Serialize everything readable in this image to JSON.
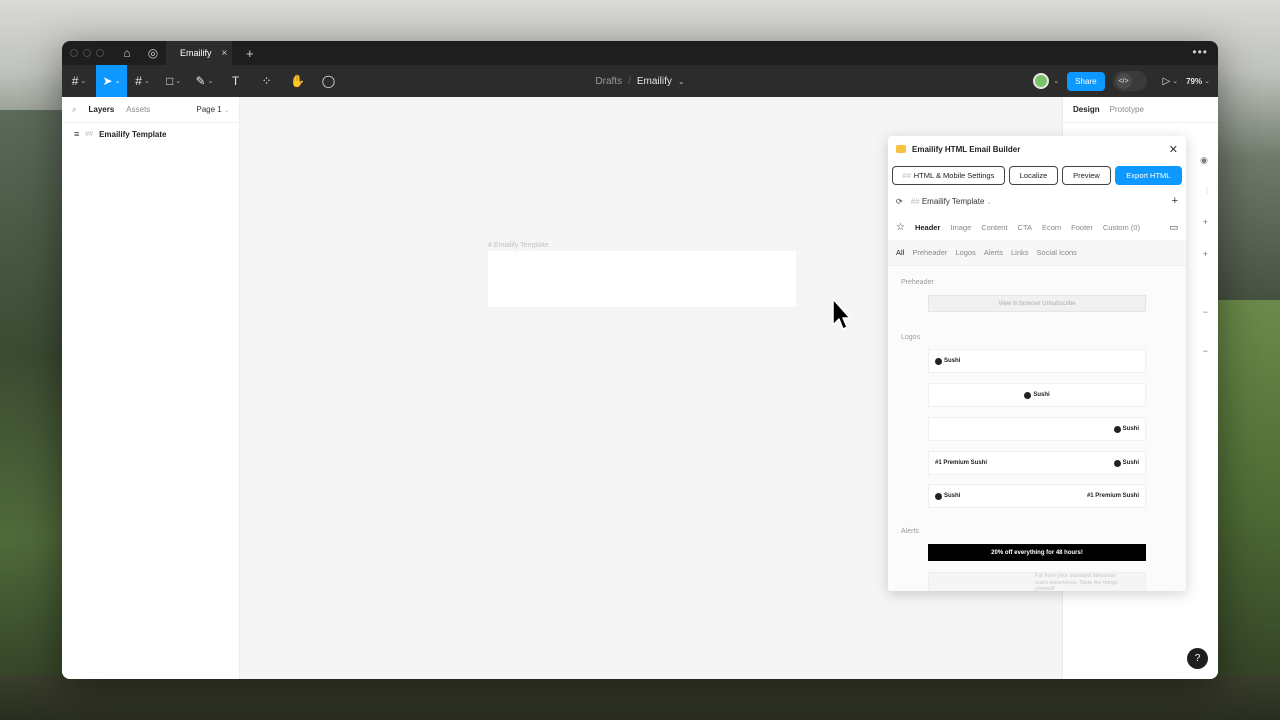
{
  "tabs": {
    "active_title": "Emailify"
  },
  "toolbar": {
    "breadcrumb_drafts": "Drafts",
    "breadcrumb_sep": "/",
    "breadcrumb_file": "Emailify",
    "share_label": "Share",
    "zoom": "79%"
  },
  "left_panel": {
    "tab_layers": "Layers",
    "tab_assets": "Assets",
    "page_selector": "Page 1",
    "layers": [
      {
        "name": "Emailify Template"
      }
    ]
  },
  "canvas": {
    "frame_label": "# Emailify Template"
  },
  "right_panel": {
    "tab_design": "Design",
    "tab_prototype": "Prototype",
    "help_label": "?"
  },
  "plugin": {
    "title": "Emailify HTML Email Builder",
    "buttons": {
      "settings": "HTML & Mobile Settings",
      "localize": "Localize",
      "preview": "Preview",
      "export": "Export HTML"
    },
    "template_name": "Emailify Template",
    "categories": [
      "Header",
      "Image",
      "Content",
      "CTA",
      "Ecom",
      "Footer",
      "Custom (0)"
    ],
    "subcategories": [
      "All",
      "Preheader",
      "Logos",
      "Alerts",
      "Links",
      "Social Icons"
    ],
    "sections": {
      "preheader": "Preheader",
      "logos": "Logos",
      "alerts": "Alerts"
    },
    "preheader_text": "View in browser  Unsubscribe",
    "logo_text": "Sushi",
    "logo_tagline": "Premium",
    "premium_text": "#1 Premium Sushi",
    "alert_text": "20% off everything for 48 hours!",
    "faded_text": "Far from your standard takeaway sushi experience. Taste the things yourself"
  }
}
